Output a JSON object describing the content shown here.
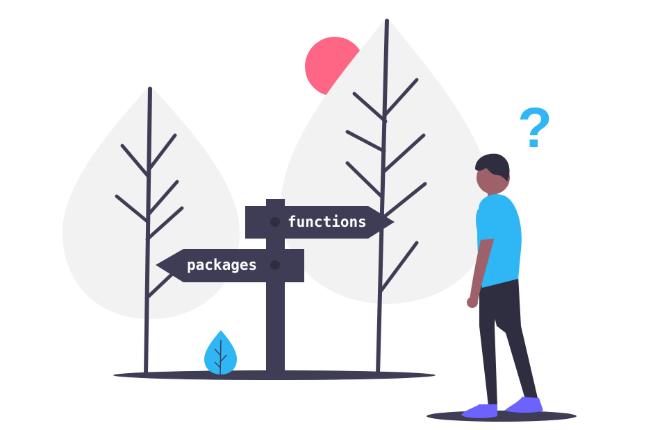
{
  "signpost": {
    "right_sign_label": "functions",
    "left_sign_label": "packages"
  },
  "question_mark": "?",
  "colors": {
    "dark": "#3f3d56",
    "leaf": "#f2f2f2",
    "sun": "#ff6584",
    "accent": "#2fb6f5",
    "skin": "#9e616a",
    "hair": "#2f2e41",
    "shoe": "#6c63ff"
  }
}
